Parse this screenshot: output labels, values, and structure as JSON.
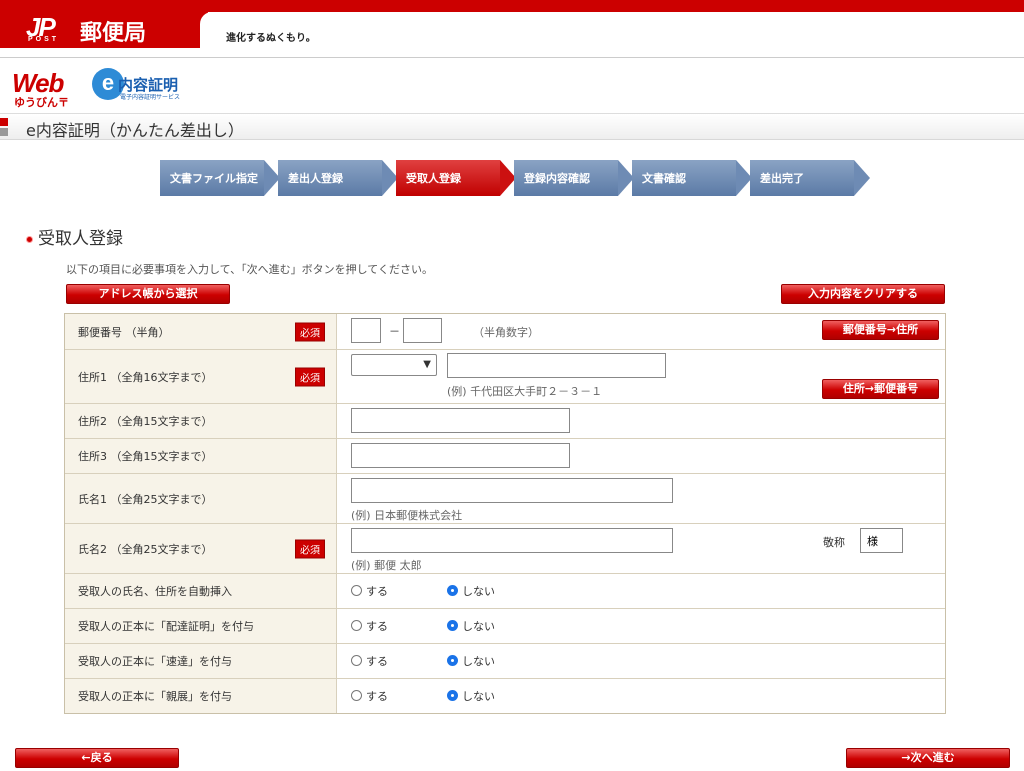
{
  "header": {
    "logo_mark": "JP",
    "logo_post": "POST",
    "logo_name": "郵便局",
    "tagline": "進化するぬくもり。",
    "web_logo": "Web",
    "web_sub": "ゆうびん〒",
    "e_logo": "内容証明",
    "e_logo_mark": "e",
    "e_logo_small": "電子内容証明サービス"
  },
  "page_title": "e内容証明（かんたん差出し）",
  "steps": [
    {
      "label": "文書ファイル指定",
      "active": false
    },
    {
      "label": "差出人登録",
      "active": false
    },
    {
      "label": "受取人登録",
      "active": true
    },
    {
      "label": "登録内容確認",
      "active": false
    },
    {
      "label": "文書確認",
      "active": false
    },
    {
      "label": "差出完了",
      "active": false
    }
  ],
  "section_title": "受取人登録",
  "instructions": "以下の項目に必要事項を入力して、「次へ進む」ボタンを押してください。",
  "buttons": {
    "address_book": "アドレス帳から選択",
    "clear": "入力内容をクリアする",
    "zip_to_addr": "郵便番号→住所",
    "addr_to_zip": "住所→郵便番号",
    "back": "←戻る",
    "next": "→次へ進む"
  },
  "required_label": "必須",
  "fields": {
    "postal": {
      "label": "郵便番号 （半角）",
      "dash": "－",
      "hint": "（半角数字）",
      "value1": "",
      "value2": ""
    },
    "addr1": {
      "label": "住所1 （全角16文字まで）",
      "hint": "(例) 千代田区大手町２－３－１",
      "value": ""
    },
    "addr2": {
      "label": "住所2 （全角15文字まで）",
      "value": ""
    },
    "addr3": {
      "label": "住所3 （全角15文字まで）",
      "value": ""
    },
    "name1": {
      "label": "氏名1 （全角25文字まで）",
      "hint": "(例) 日本郵便株式会社",
      "value": ""
    },
    "name2": {
      "label": "氏名2 （全角25文字まで）",
      "hint": "(例) 郵便 太郎",
      "value": "",
      "honorific_label": "敬称",
      "honorific_value": "様"
    }
  },
  "radio_rows": [
    {
      "label": "受取人の氏名、住所を自動挿入",
      "yes": "する",
      "no": "しない",
      "selected": "no"
    },
    {
      "label": "受取人の正本に「配達証明」を付与",
      "yes": "する",
      "no": "しない",
      "selected": "no"
    },
    {
      "label": "受取人の正本に「速達」を付与",
      "yes": "する",
      "no": "しない",
      "selected": "no"
    },
    {
      "label": "受取人の正本に「親展」を付与",
      "yes": "する",
      "no": "しない",
      "selected": "no"
    }
  ]
}
